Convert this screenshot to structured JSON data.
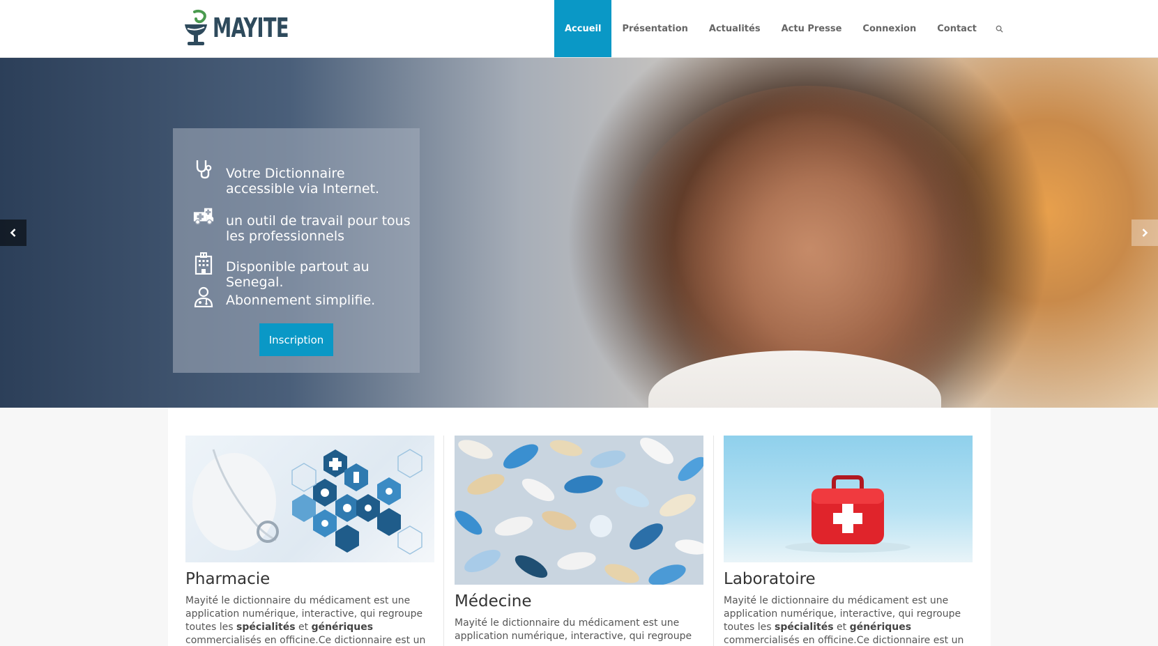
{
  "brand": {
    "name": "MAYITE"
  },
  "nav": {
    "items": [
      {
        "label": "Accueil",
        "active": true
      },
      {
        "label": "Présentation",
        "active": false
      },
      {
        "label": "Actualités",
        "active": false
      },
      {
        "label": "Actu Presse",
        "active": false
      },
      {
        "label": "Connexion",
        "active": false
      },
      {
        "label": "Contact",
        "active": false
      }
    ],
    "search_icon": "search-icon"
  },
  "hero": {
    "features": [
      {
        "icon": "stethoscope-icon",
        "text": "Votre Dictionnaire accessible via Internet."
      },
      {
        "icon": "ambulance-icon",
        "text": "un outil de travail pour tous les professionnels"
      },
      {
        "icon": "hospital-icon",
        "text": "Disponible partout au Senegal."
      },
      {
        "icon": "doctor-icon",
        "text": "Abonnement simplifie."
      }
    ],
    "cta_label": "Inscription",
    "prev_icon": "chevron-left-icon",
    "next_icon": "chevron-right-icon"
  },
  "cards": [
    {
      "title": "Pharmacie",
      "text_pre": "Mayité le dictionnaire du médicament est une application numérique, interactive, qui regroupe toutes les ",
      "bold1": "spécialités",
      "text_mid": " et  ",
      "bold2": "génériques",
      "text_post": " commercialisés en officine.Ce dictionnaire est un outil local unique au"
    },
    {
      "title": "Médecine",
      "text_pre": "Mayité le dictionnaire du médicament est une application numérique, interactive, qui regroupe",
      "bold1": "",
      "text_mid": "",
      "bold2": "",
      "text_post": ""
    },
    {
      "title": "Laboratoire",
      "text_pre": "Mayité le dictionnaire du médicament est une application numérique, interactive, qui regroupe toutes les ",
      "bold1": "spécialités",
      "text_mid": " et  ",
      "bold2": "génériques",
      "text_post": " commercialisés en officine.Ce dictionnaire est un outil local unique au"
    }
  ],
  "colors": {
    "accent": "#0a98c6",
    "logo": "#2e4a5c",
    "logo_leaf": "#4a9a4e"
  }
}
